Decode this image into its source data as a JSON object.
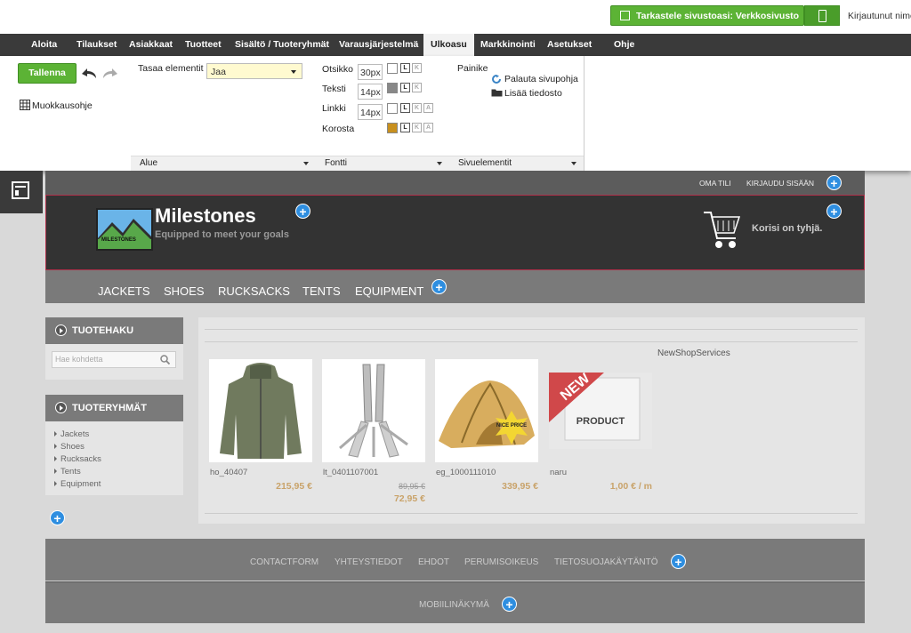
{
  "topbar": {
    "view_site_label": "Tarkastele sivustoasi: Verkkosivusto",
    "logged_in_text": "Kirjautunut nimellä"
  },
  "menu": [
    "Aloita",
    "Tilaukset",
    "Asiakkaat",
    "Tuotteet",
    "Sisältö / Tuoteryhmät",
    "Varausjärjestelmä",
    "Ulkoasu",
    "Markkinointi",
    "Asetukset",
    "Ohje"
  ],
  "menu_active": "Ulkoasu",
  "ribbon": {
    "save_label": "Tallenna",
    "edit_guide_label": "Muokkausohje",
    "align_label": "Tasaa elementit",
    "align_value": "Jaa",
    "area_footer": "Alue",
    "font_footer": "Fontti",
    "page_elements_footer": "Sivuelementit",
    "font_rows": [
      {
        "label": "Otsikko",
        "size": "30px",
        "color": "#ffffff"
      },
      {
        "label": "Teksti",
        "size": "14px",
        "color": "#888888"
      },
      {
        "label": "Linkki",
        "size": "14px",
        "color": "#ffffff"
      },
      {
        "label": "Korosta",
        "size": "",
        "color": "#c8901e"
      }
    ],
    "button_label": "Painike",
    "restore_template": "Palauta sivupohja",
    "add_file": "Lisää tiedosto"
  },
  "site": {
    "top_links": [
      "OMA TILI",
      "KIRJAUDU SISÄÄN"
    ],
    "title": "Milestones",
    "slogan": "Equipped to meet your goals",
    "logo_text": "MILESTONES",
    "cart_text": "Korisi on tyhjä.",
    "categories": [
      "JACKETS",
      "SHOES",
      "RUCKSACKS",
      "TENTS",
      "EQUIPMENT"
    ],
    "search_box_title": "TUOTEHAKU",
    "search_placeholder": "Hae kohdetta",
    "groups_title": "TUOTERYHMÄT",
    "groups": [
      "Jackets",
      "Shoes",
      "Rucksacks",
      "Tents",
      "Equipment"
    ],
    "content_caption": "NewShopServices",
    "products": [
      {
        "name": "ho_40407",
        "price": "215,95 €",
        "old_price": ""
      },
      {
        "name": "lt_0401107001",
        "price": "72,95 €",
        "old_price": "89,95 €"
      },
      {
        "name": "eg_1000111010",
        "price": "339,95 €",
        "old_price": ""
      },
      {
        "name": "naru",
        "price": "1,00 € / m",
        "old_price": ""
      }
    ],
    "badge_nice_price": "NICE PRICE",
    "badge_new": "NEW",
    "badge_product": "PRODUCT",
    "footer_links": [
      "CONTACTFORM",
      "YHTEYSTIEDOT",
      "EHDOT",
      "PERUMISOIKEUS",
      "TIETOSUOJAKÄYTÄNTÖ"
    ],
    "mobile_label": "MOBIILINÄKYMÄ"
  },
  "colors": {
    "accent_green": "#5cb335",
    "menu_dark": "#3a3a3a",
    "plus_blue": "#2e8ee0",
    "price_gold": "#c9a36a"
  }
}
